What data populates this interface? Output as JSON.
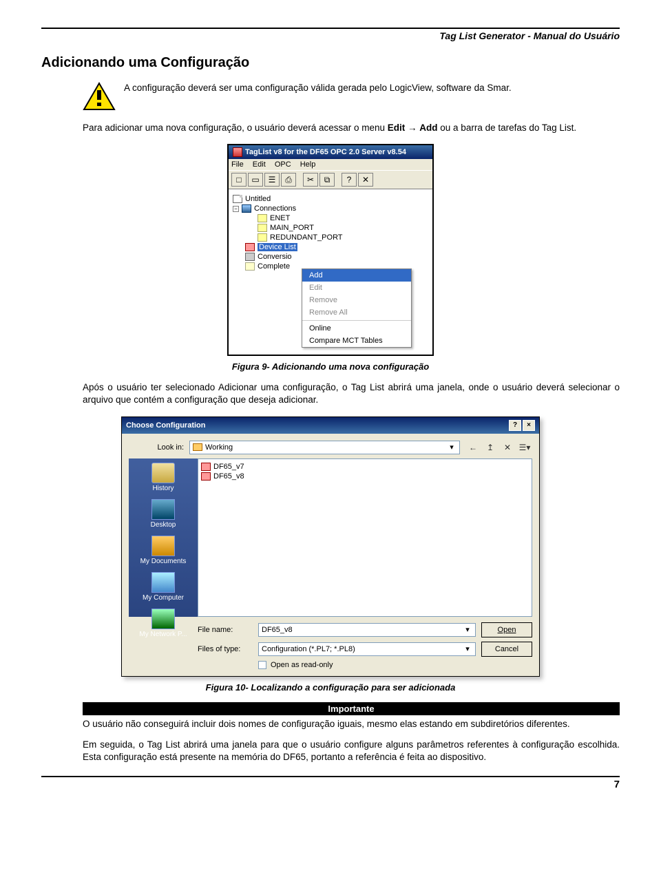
{
  "header": {
    "doc_title": "Tag List Generator - Manual do Usuário"
  },
  "section": {
    "title": "Adicionando uma Configuração"
  },
  "warning": {
    "text": "A configuração deverá ser uma configuração válida gerada pelo LogicView, software da Smar."
  },
  "intro": {
    "pre": "Para adicionar uma nova configuração, o usuário deverá acessar o menu ",
    "b1": "Edit",
    "arrow": " → ",
    "b2": "Add",
    "post": " ou a barra de tarefas do Tag List."
  },
  "win1": {
    "title": "TagList v8 for the DF65 OPC 2.0 Server v8.54",
    "menus": [
      "File",
      "Edit",
      "OPC",
      "Help"
    ],
    "toolbar_icons": [
      "□",
      "▭",
      "☰",
      "⎙",
      "✂",
      "⧉",
      "?",
      "✕"
    ],
    "tree": {
      "root": "Untitled",
      "connections": "Connections",
      "ports": [
        "ENET",
        "MAIN_PORT",
        "REDUNDANT_PORT"
      ],
      "devicelist": "Device List",
      "conversion": "Conversio",
      "complete": "Complete"
    },
    "context_menu": {
      "items": [
        "Add",
        "Edit",
        "Remove",
        "Remove All",
        "Online",
        "Compare MCT Tables"
      ],
      "highlighted": 0,
      "disabled": [
        1,
        2,
        3
      ]
    }
  },
  "caption1": "Figura 9- Adicionando uma nova configuração",
  "after_fig1": "Após o usuário ter selecionado Adicionar uma configuração, o Tag List abrirá uma janela, onde o usuário deverá selecionar o arquivo que contém a configuração que deseja adicionar.",
  "dlg": {
    "title": "Choose Configuration",
    "lookin_label": "Look in:",
    "lookin_value": "Working",
    "navicons": [
      "←",
      "↥",
      "✕",
      "☰▾"
    ],
    "files": [
      "DF65_v7",
      "DF65_v8"
    ],
    "places": [
      "History",
      "Desktop",
      "My Documents",
      "My Computer",
      "My Network P..."
    ],
    "filename_label": "File name:",
    "filename_value": "DF65_v8",
    "filetype_label": "Files of type:",
    "filetype_value": "Configuration (*.PL7; *.PL8)",
    "open_btn": "Open",
    "cancel_btn": "Cancel",
    "readonly_label": "Open as read-only",
    "help_btn": "?",
    "close_btn": "×"
  },
  "caption2": "Figura 10- Localizando a configuração para ser adicionada",
  "importante": {
    "header": "Importante",
    "body": "O usuário não conseguirá incluir dois nomes de configuração iguais, mesmo elas estando em subdiretórios diferentes."
  },
  "closing": "Em seguida, o Tag List abrirá uma janela para que o usuário configure alguns parâmetros referentes à configuração escolhida. Esta configuração está presente na memória do DF65, portanto a referência é feita ao dispositivo.",
  "page_number": "7"
}
